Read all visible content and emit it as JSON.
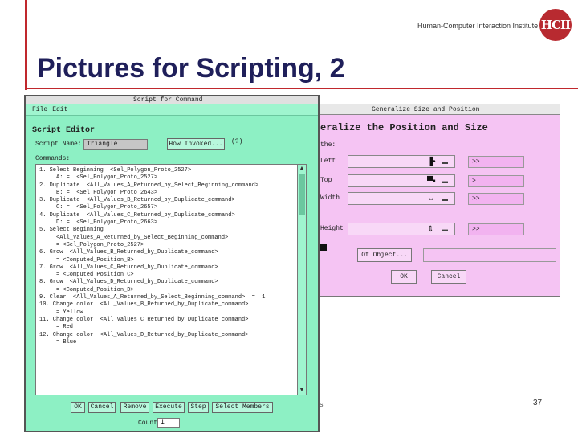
{
  "slide": {
    "title": "Pictures for Scripting, 2",
    "org_name": "Human-Computer Interaction Institute",
    "logo_text": "HCII",
    "page_number": "37",
    "footer_fragment": "s"
  },
  "colors": {
    "accent": "#c0282d",
    "script_editor_bg": "#8df0c4",
    "generalize_bg": "#f5c4f3"
  },
  "script_editor": {
    "window_title": "Script for Command",
    "menu": [
      "File",
      "Edit"
    ],
    "heading": "Script Editor",
    "name_label": "Script Name:",
    "name_value": "Triangle",
    "how_invoked_label": "How Invoked...",
    "hint": "(?)",
    "commands_label": "Commands:",
    "commands": [
      "1. Select Beginning  <Sel_Polygon_Proto_2527>",
      "     A: =  <Sel_Polygon_Proto_2527>",
      "2. Duplicate  <All_Values_A_Returned_by_Select_Beginning_command>",
      "     B: =  <Sel_Polygon_Proto_2643>",
      "3. Duplicate  <All_Values_B_Returned_by_Duplicate_command>",
      "     C: =  <Sel_Polygon_Proto_2657>",
      "4. Duplicate  <All_Values_C_Returned_by_Duplicate_command>",
      "     D: =  <Sel_Polygon_Proto_2663>",
      "5. Select Beginning",
      "     <All_Values_A_Returned_by_Select_Beginning_command>",
      "     = <Sel_Polygon_Proto_2527>",
      "6. Grow  <All_Values_B_Returned_by_Duplicate_command>",
      "     = <Computed_Position_B>",
      "7. Grow  <All_Values_C_Returned_by_Duplicate_command>",
      "     = <Computed_Position_C>",
      "8. Grow  <All_Values_D_Returned_by_Duplicate_command>",
      "     = <Computed_Position_D>",
      "9. Clear  <All_Values_A_Returned_by_Select_Beginning_command>  =  1",
      "10. Change color  <All_Values_B_Returned_by_Duplicate_command>",
      "     = Yellow",
      "11. Change color  <All_Values_C_Returned_by_Duplicate_command>",
      "     = Red",
      "12. Change color  <All_Values_D_Returned_by_Duplicate_command>",
      "     = Blue"
    ],
    "buttons": [
      "OK",
      "Cancel",
      "Remove",
      "Execute",
      "Step",
      "Select Members"
    ],
    "count_label": "Count",
    "count_value": "1"
  },
  "generalize": {
    "window_title": "Generalize Size and Position",
    "heading": "eralize the Position and Size",
    "subheading": "the:",
    "rows": [
      {
        "label": "Left",
        "icon": "▐•",
        "value": ">>"
      },
      {
        "label": "Top",
        "icon": "▀▪",
        "value": ">"
      },
      {
        "label": "Width",
        "icon": "⇔",
        "value": ">>"
      },
      {
        "label": "Height",
        "icon": "⇕",
        "value": ">>"
      }
    ],
    "of_object_label": "Of Object...",
    "ok_label": "OK",
    "cancel_label": "Cancel"
  }
}
